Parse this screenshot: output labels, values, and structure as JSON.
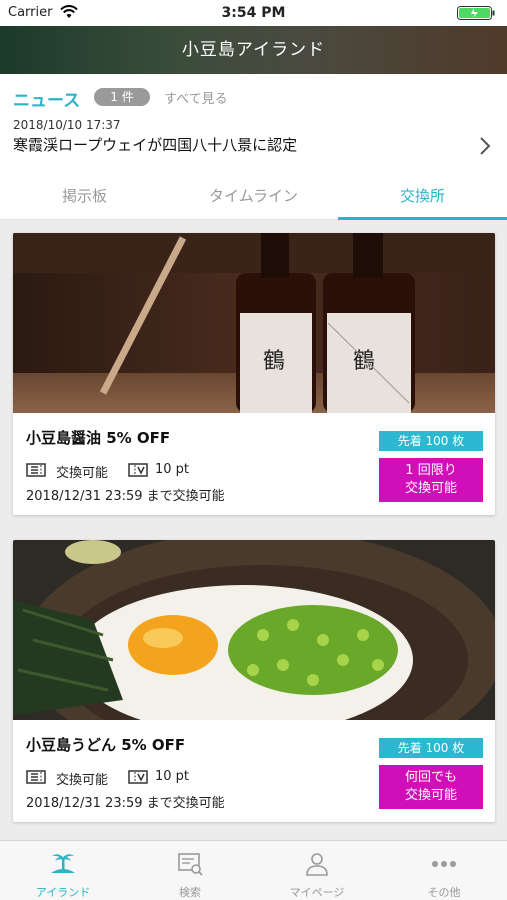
{
  "status_bar": {
    "carrier": "Carrier",
    "time": "3:54 PM"
  },
  "nav": {
    "title": "小豆島アイランド"
  },
  "news": {
    "label": "ニュース",
    "count": "1 件",
    "see_all": "すべて見る",
    "date": "2018/10/10 17:37",
    "headline": "寒霞渓ロープウェイが四国八十八景に認定"
  },
  "tabs": [
    {
      "label": "掲示板"
    },
    {
      "label": "タイムライン"
    },
    {
      "label": "交換所"
    }
  ],
  "cards": [
    {
      "title": "小豆島醤油 5% OFF",
      "exchange_label": "交換可能",
      "points": "10 pt",
      "deadline": "2018/12/31 23:59 まで交換可能",
      "badge_first": "先着 100 枚",
      "badge_limit_line1": "1 回限り",
      "badge_limit_line2": "交換可能"
    },
    {
      "title": "小豆島うどん 5% OFF",
      "exchange_label": "交換可能",
      "points": "10 pt",
      "deadline": "2018/12/31 23:59 まで交換可能",
      "badge_first": "先着 100 枚",
      "badge_limit_line1": "何回でも",
      "badge_limit_line2": "交換可能"
    }
  ],
  "tab_bar": [
    {
      "label": "アイランド",
      "icon": "island-icon"
    },
    {
      "label": "検索",
      "icon": "search-board-icon"
    },
    {
      "label": "マイページ",
      "icon": "person-icon"
    },
    {
      "label": "その他",
      "icon": "more-icon"
    }
  ],
  "colors": {
    "accent": "#2bb3c7",
    "badge_first": "#2bb8d0",
    "badge_limit": "#d10fb8"
  }
}
